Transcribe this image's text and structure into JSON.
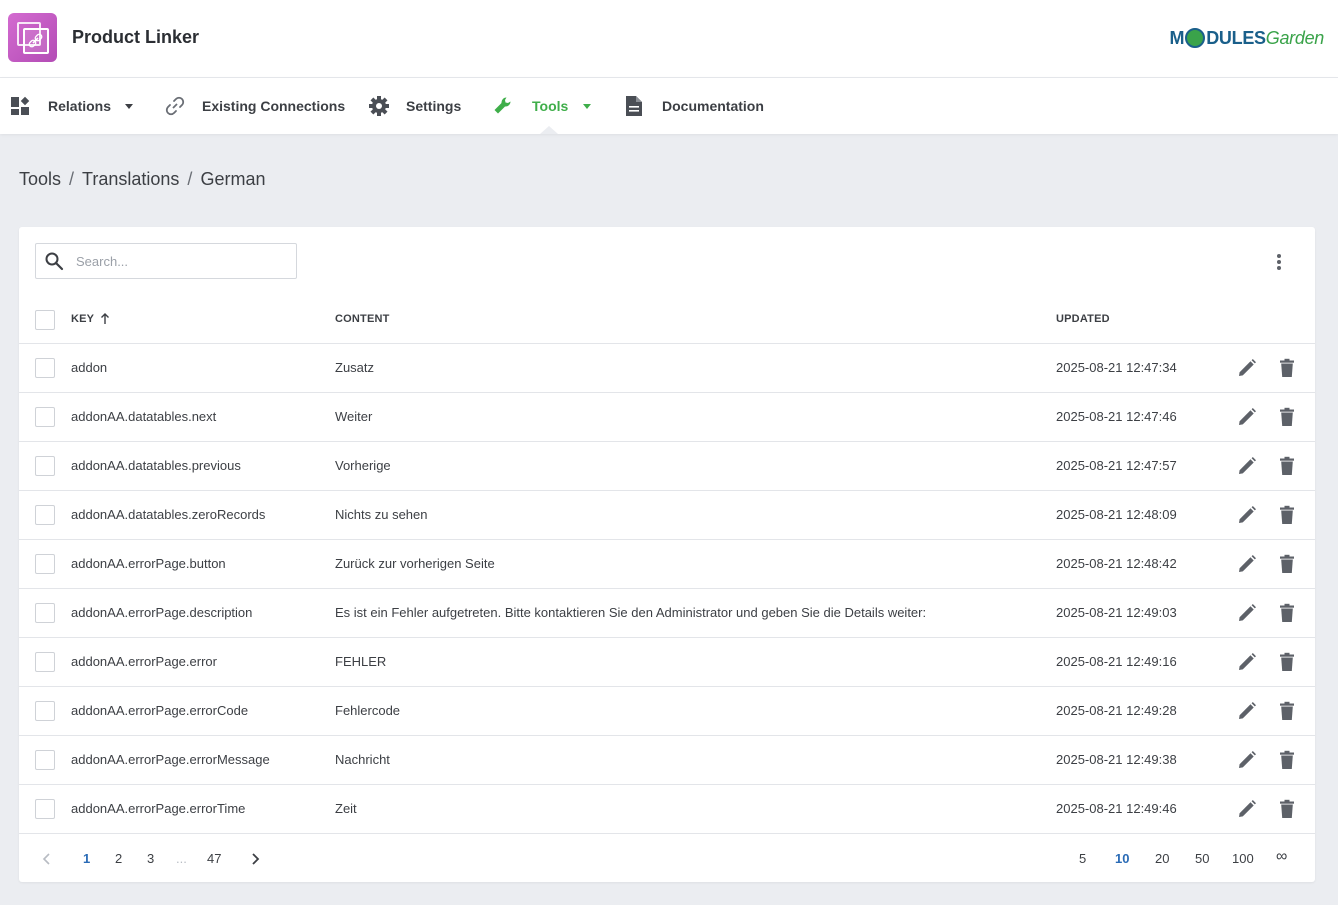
{
  "header": {
    "app_title": "Product Linker",
    "brand": {
      "part1": "M",
      "part2": "DULES",
      "part3": "Garden"
    }
  },
  "nav": {
    "items": [
      {
        "label": "Relations",
        "icon": "dashboard-icon",
        "dropdown": true
      },
      {
        "label": "Existing Connections",
        "icon": "link-icon",
        "dropdown": false
      },
      {
        "label": "Settings",
        "icon": "gear-icon",
        "dropdown": false
      },
      {
        "label": "Tools",
        "icon": "wrench-icon",
        "dropdown": true,
        "active": true
      },
      {
        "label": "Documentation",
        "icon": "document-icon",
        "dropdown": false
      }
    ],
    "active_color": "#3fae4a"
  },
  "breadcrumb": {
    "items": [
      "Tools",
      "Translations",
      "German"
    ],
    "separator": "/"
  },
  "search": {
    "placeholder": "Search...",
    "value": ""
  },
  "table": {
    "columns": {
      "key": "KEY",
      "content": "CONTENT",
      "updated": "UPDATED"
    },
    "sort": {
      "column": "key",
      "direction": "asc"
    },
    "rows": [
      {
        "key": "addon",
        "content": "Zusatz",
        "updated": "2025-08-21 12:47:34"
      },
      {
        "key": "addonAA.datatables.next",
        "content": "Weiter",
        "updated": "2025-08-21 12:47:46"
      },
      {
        "key": "addonAA.datatables.previous",
        "content": "Vorherige",
        "updated": "2025-08-21 12:47:57"
      },
      {
        "key": "addonAA.datatables.zeroRecords",
        "content": "Nichts zu sehen",
        "updated": "2025-08-21 12:48:09"
      },
      {
        "key": "addonAA.errorPage.button",
        "content": "Zurück zur vorherigen Seite",
        "updated": "2025-08-21 12:48:42"
      },
      {
        "key": "addonAA.errorPage.description",
        "content": "Es ist ein Fehler aufgetreten. Bitte kontaktieren Sie den Administrator und geben Sie die Details weiter:",
        "updated": "2025-08-21 12:49:03"
      },
      {
        "key": "addonAA.errorPage.error",
        "content": "FEHLER",
        "updated": "2025-08-21 12:49:16"
      },
      {
        "key": "addonAA.errorPage.errorCode",
        "content": "Fehlercode",
        "updated": "2025-08-21 12:49:28"
      },
      {
        "key": "addonAA.errorPage.errorMessage",
        "content": "Nachricht",
        "updated": "2025-08-21 12:49:38"
      },
      {
        "key": "addonAA.errorPage.errorTime",
        "content": "Zeit",
        "updated": "2025-08-21 12:49:46"
      }
    ]
  },
  "pagination": {
    "pages": [
      "1",
      "2",
      "3",
      "...",
      "47"
    ],
    "current_page": "1",
    "page_sizes": [
      "5",
      "10",
      "20",
      "50",
      "100",
      "∞"
    ],
    "current_page_size": "10"
  },
  "colors": {
    "accent_green": "#3fae4a",
    "link_blue": "#2a6bb6",
    "logo_magenta": "#c35dc3"
  }
}
